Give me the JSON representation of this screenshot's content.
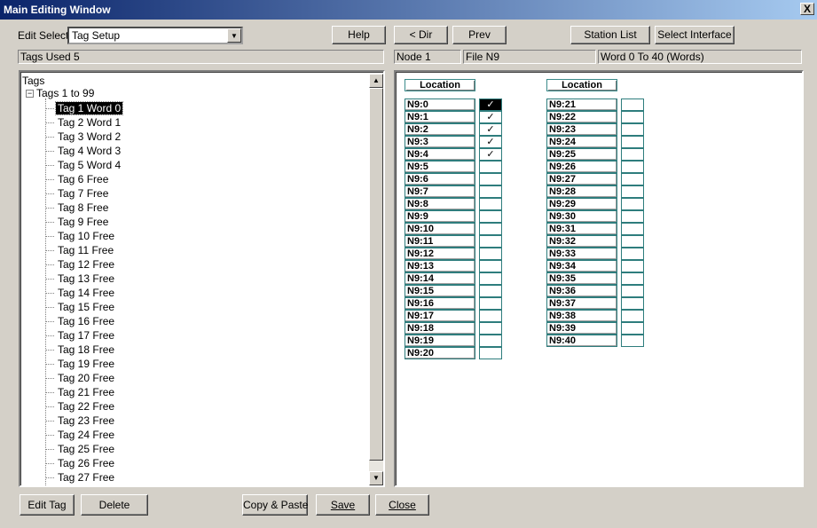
{
  "window": {
    "title": "Main Editing Window",
    "close_glyph": "X"
  },
  "toolbar": {
    "edit_select_label": "Edit Select",
    "edit_select_value": "Tag Setup",
    "help": "Help",
    "dir": "< Dir",
    "prev": "Prev",
    "station_list": "Station List",
    "select_interface": "Select Interface"
  },
  "status": {
    "tags_used": "Tags Used 5",
    "node": "Node 1",
    "file": "File N9",
    "range": "Word 0 To 40 (Words)"
  },
  "tree": {
    "root": "Tags",
    "group": "Tags 1 to 99",
    "items": [
      "Tag 1 Word 0",
      "Tag 2 Word 1",
      "Tag 3 Word 2",
      "Tag 4 Word 3",
      "Tag 5 Word 4",
      "Tag 6 Free",
      "Tag 7 Free",
      "Tag 8 Free",
      "Tag 9 Free",
      "Tag 10 Free",
      "Tag 11 Free",
      "Tag 12 Free",
      "Tag 13 Free",
      "Tag 14 Free",
      "Tag 15 Free",
      "Tag 16 Free",
      "Tag 17 Free",
      "Tag 18 Free",
      "Tag 19 Free",
      "Tag 20 Free",
      "Tag 21 Free",
      "Tag 22 Free",
      "Tag 23 Free",
      "Tag 24 Free",
      "Tag 25 Free",
      "Tag 26 Free",
      "Tag 27 Free"
    ],
    "selected_index": 0
  },
  "locations": {
    "header": "Location",
    "col1": [
      {
        "addr": "N9:0",
        "checked": true,
        "selected": true
      },
      {
        "addr": "N9:1",
        "checked": true
      },
      {
        "addr": "N9:2",
        "checked": true
      },
      {
        "addr": "N9:3",
        "checked": true
      },
      {
        "addr": "N9:4",
        "checked": true
      },
      {
        "addr": "N9:5",
        "checked": false
      },
      {
        "addr": "N9:6",
        "checked": false
      },
      {
        "addr": "N9:7",
        "checked": false
      },
      {
        "addr": "N9:8",
        "checked": false
      },
      {
        "addr": "N9:9",
        "checked": false
      },
      {
        "addr": "N9:10",
        "checked": false
      },
      {
        "addr": "N9:11",
        "checked": false
      },
      {
        "addr": "N9:12",
        "checked": false
      },
      {
        "addr": "N9:13",
        "checked": false
      },
      {
        "addr": "N9:14",
        "checked": false
      },
      {
        "addr": "N9:15",
        "checked": false
      },
      {
        "addr": "N9:16",
        "checked": false
      },
      {
        "addr": "N9:17",
        "checked": false
      },
      {
        "addr": "N9:18",
        "checked": false
      },
      {
        "addr": "N9:19",
        "checked": false
      },
      {
        "addr": "N9:20",
        "checked": false
      }
    ],
    "col2": [
      {
        "addr": "N9:21",
        "checked": false
      },
      {
        "addr": "N9:22",
        "checked": false
      },
      {
        "addr": "N9:23",
        "checked": false
      },
      {
        "addr": "N9:24",
        "checked": false
      },
      {
        "addr": "N9:25",
        "checked": false
      },
      {
        "addr": "N9:26",
        "checked": false
      },
      {
        "addr": "N9:27",
        "checked": false
      },
      {
        "addr": "N9:28",
        "checked": false
      },
      {
        "addr": "N9:29",
        "checked": false
      },
      {
        "addr": "N9:30",
        "checked": false
      },
      {
        "addr": "N9:31",
        "checked": false
      },
      {
        "addr": "N9:32",
        "checked": false
      },
      {
        "addr": "N9:33",
        "checked": false
      },
      {
        "addr": "N9:34",
        "checked": false
      },
      {
        "addr": "N9:35",
        "checked": false
      },
      {
        "addr": "N9:36",
        "checked": false
      },
      {
        "addr": "N9:37",
        "checked": false
      },
      {
        "addr": "N9:38",
        "checked": false
      },
      {
        "addr": "N9:39",
        "checked": false
      },
      {
        "addr": "N9:40",
        "checked": false
      }
    ],
    "check_glyph": "✓"
  },
  "bottom": {
    "edit_tag": "Edit Tag",
    "delete": "Delete",
    "copy_paste": "Copy & Paste",
    "save": "Save",
    "close": "Close"
  },
  "icons": {
    "expander": "minus-box-icon",
    "scroll_up": "arrow-up-icon",
    "scroll_down": "arrow-down-icon",
    "dropdown": "chevron-down-icon"
  }
}
